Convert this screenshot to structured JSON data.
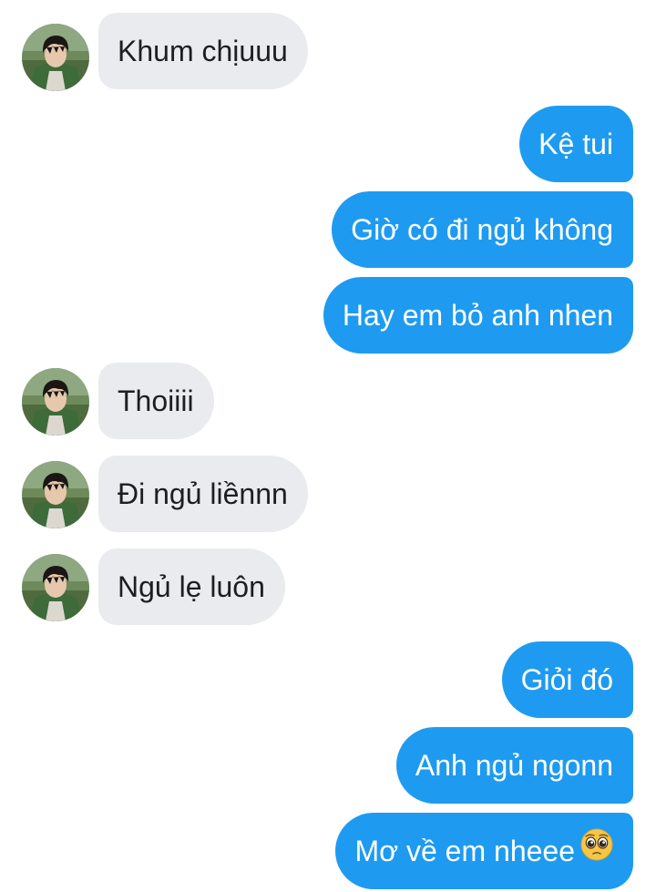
{
  "messages": [
    {
      "side": "received",
      "text": "Khum chịuuu"
    },
    {
      "side": "sent",
      "text": "Kệ tui"
    },
    {
      "side": "sent",
      "text": "Giờ có đi ngủ không"
    },
    {
      "side": "sent",
      "text": "Hay em bỏ anh nhen"
    },
    {
      "side": "received",
      "text": "Thoiiii"
    },
    {
      "side": "received",
      "text": "Đi ngủ liềnnn"
    },
    {
      "side": "received",
      "text": "Ngủ lẹ luôn"
    },
    {
      "side": "sent",
      "text": "Giỏi đó"
    },
    {
      "side": "sent",
      "text": "Anh ngủ ngonn"
    },
    {
      "side": "sent",
      "text": "Mơ về em nheee",
      "emoji": "pleading-face-icon"
    }
  ],
  "colors": {
    "sent_bubble": "#1e9bf0",
    "received_bubble": "#e9ebee",
    "received_text": "#1c1e21",
    "sent_text": "#ffffff"
  },
  "icons": {
    "avatar": "profile-photo-avatar",
    "emoji": "pleading-face-icon"
  }
}
